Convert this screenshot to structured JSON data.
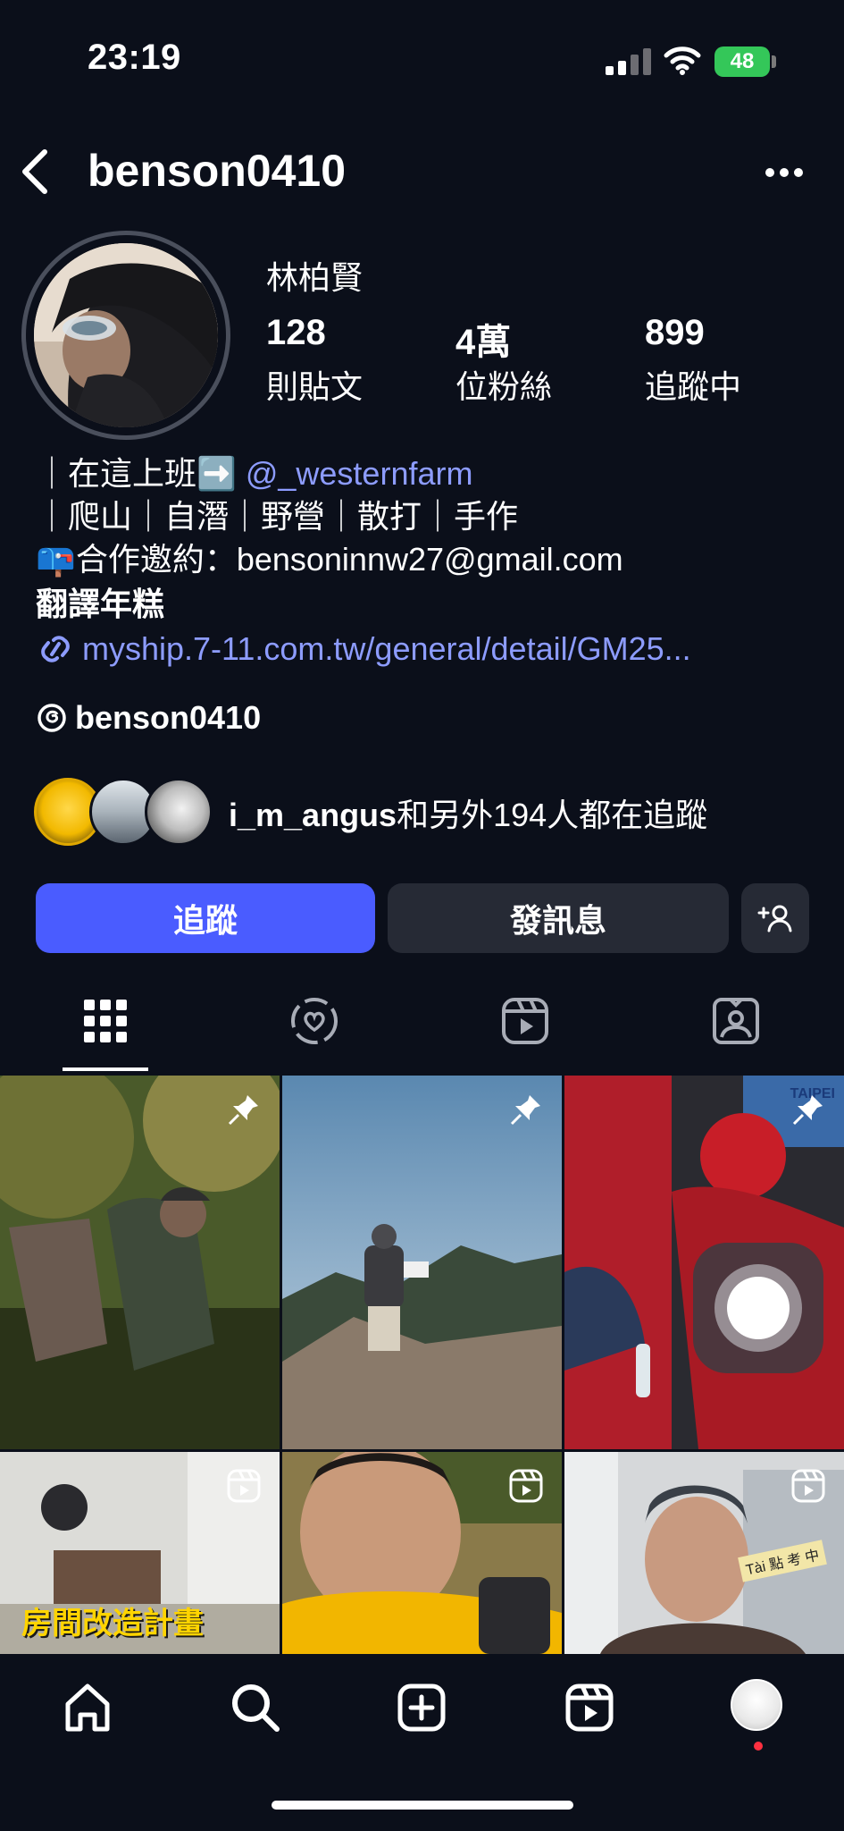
{
  "status_bar": {
    "time": "23:19",
    "battery": "48"
  },
  "header": {
    "username": "benson0410"
  },
  "profile": {
    "full_name": "林柏賢",
    "posts_count": "128",
    "posts_label": "則貼文",
    "followers_count": "4萬",
    "followers_label": "位粉絲",
    "following_count": "899",
    "following_label": "追蹤中"
  },
  "bio": {
    "line1_prefix": "｜在這上班➡️",
    "line1_mention": "@_westernfarm",
    "line2": "｜爬山｜自潛｜野營｜散打｜手作",
    "line3": "📪合作邀約：bensoninnw27@gmail.com",
    "line4": "翻譯年糕",
    "link": "myship.7-11.com.tw/general/detail/GM25..."
  },
  "threads": {
    "handle": "benson0410"
  },
  "mutual": {
    "name": "i_m_angus",
    "rest": "和另外194人都在追蹤"
  },
  "buttons": {
    "follow": "追蹤",
    "message": "發訊息"
  },
  "grid": {
    "tiles": [
      {
        "overlay": "pin-icon"
      },
      {
        "overlay": "pin-icon"
      },
      {
        "overlay": "pin-icon",
        "caption_top": "TAIPEI"
      },
      {
        "overlay": "reel-icon",
        "caption": "房間改造計畫"
      },
      {
        "overlay": "reel-icon"
      },
      {
        "overlay": "reel-icon",
        "caption": "Tài 點 考 中"
      }
    ]
  },
  "colors": {
    "accent": "#4a5cff",
    "link": "#8d9cff",
    "background": "#0b0f1a",
    "notification": "#ff3040"
  }
}
